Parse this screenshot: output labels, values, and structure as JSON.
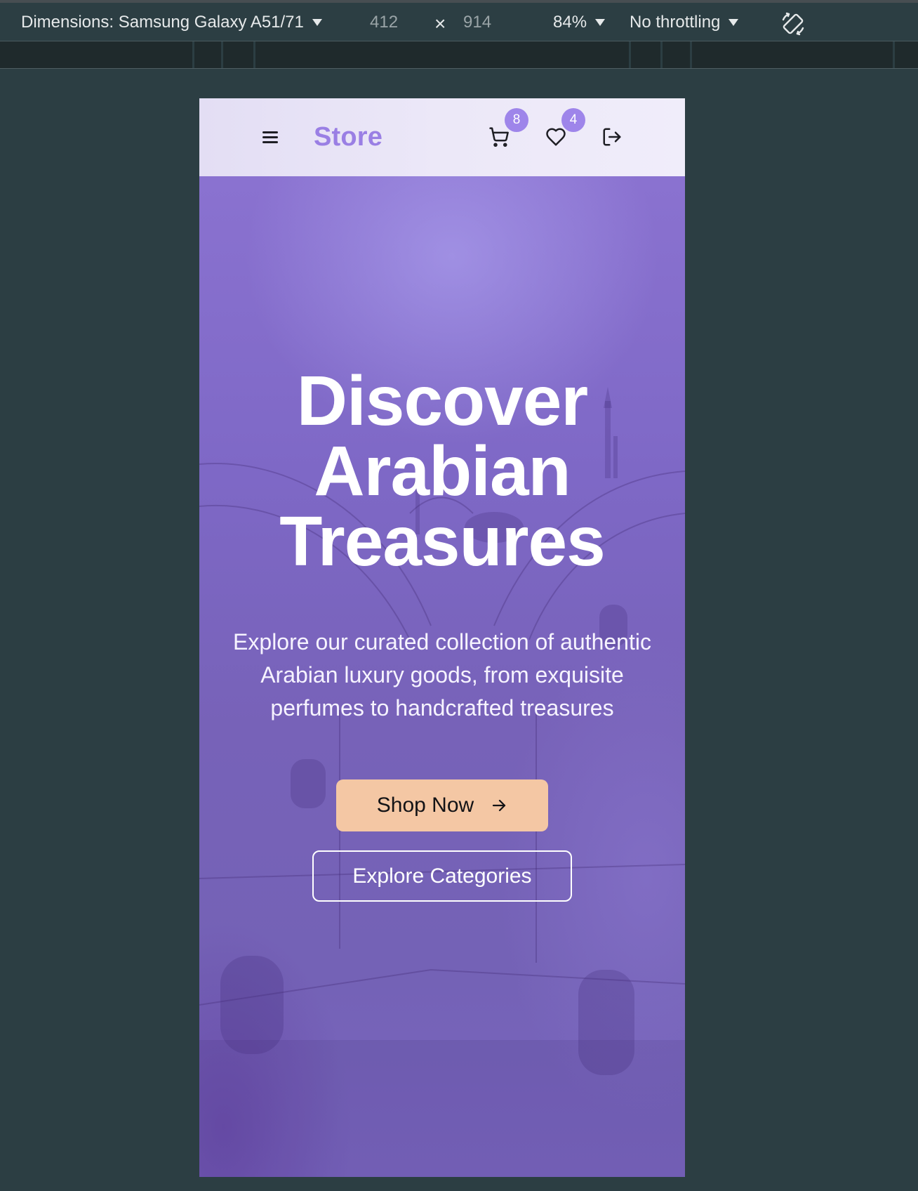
{
  "devtools": {
    "dimensions_label": "Dimensions: Samsung Galaxy A51/71",
    "width": "412",
    "times": "×",
    "height": "914",
    "zoom": "84%",
    "throttling": "No throttling",
    "rotate_icon": "rotate-device-icon"
  },
  "navbar": {
    "brand": "Store",
    "cart_count": "8",
    "wishlist_count": "4",
    "icons": [
      "menu-icon",
      "cart-icon",
      "heart-icon",
      "logout-icon"
    ]
  },
  "hero": {
    "title_lines": [
      "Discover",
      "Arabian",
      "Treasures"
    ],
    "subtitle": "Explore our curated collection of authentic Arabian luxury goods, from exquisite perfumes to handcrafted treasures",
    "primary_cta": "Shop Now",
    "secondary_cta": "Explore Categories"
  },
  "colors": {
    "brand": "#9a7fe4",
    "badge": "#9e85ea",
    "primary_button": "#f4c7a4",
    "hero_overlay": "#7e68c6",
    "devtools_bg": "#2c3e43"
  }
}
